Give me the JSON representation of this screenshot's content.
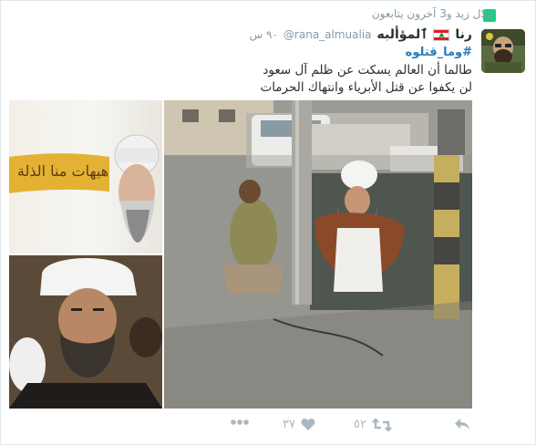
{
  "context": {
    "text": "جلال زيد و3 آخرون يتابعون",
    "icon": "person-follow-icon"
  },
  "tweet": {
    "display_name": "رنا",
    "display_name_suffix": "ٱلمؤألبه",
    "handle": "@rana_almualia",
    "time": "٩٠ س",
    "hashtag": "#وما_قتلوه",
    "text_line1": "طالما أن العالم يسكت عن ظلم آل سعود",
    "text_line2": "لن يكفوا عن قتل الأبرياء وانتهاك الحرمات"
  },
  "media": {
    "calligraphy": "هيهات منا الذلة"
  },
  "actions": {
    "reply_icon": "reply-icon",
    "retweet_icon": "retweet-icon",
    "retweet_count": "٥٢",
    "like_icon": "heart-icon",
    "like_count": "٣٧",
    "more_icon": "more-icon"
  },
  "colors": {
    "link": "#2b7bb9",
    "muted": "#8899a6",
    "action": "#aab8c2"
  }
}
